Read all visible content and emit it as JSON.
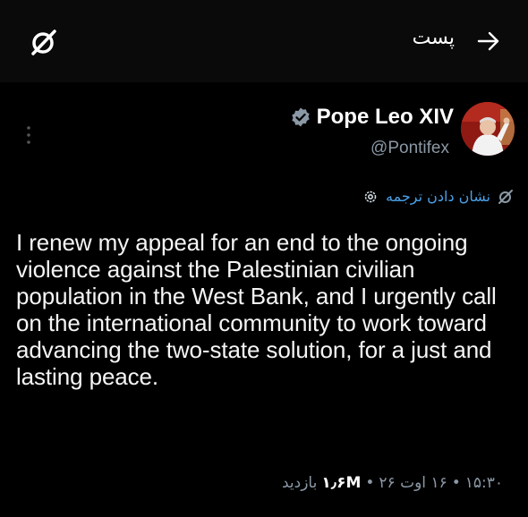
{
  "header": {
    "title": "پست",
    "back_icon": "arrow-right-icon",
    "logo_icon": "grok-logo-icon"
  },
  "post": {
    "author_name": "Pope Leo XIV",
    "handle": "@Pontifex",
    "verified_color": "#8b98a5",
    "translate_label": "نشان دادن ترجمه",
    "text": "I renew my appeal for an end to the ongoing violence against the Palestinian civilian population in the West Bank, and I urgently call on the international community to work toward advancing the two-state solution, for a just and lasting peace.",
    "time": "۱۵:۳۰",
    "date": "۱۶ اوت ۲۶",
    "views_count": "۱٫۶M",
    "views_label": "بازدید",
    "separator": "•"
  },
  "colors": {
    "background": "#000000",
    "link": "#4aa0e8",
    "muted": "#8b98a5"
  }
}
